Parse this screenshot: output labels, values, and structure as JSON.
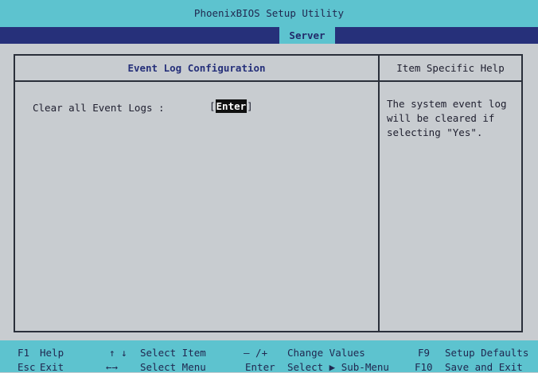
{
  "header": {
    "title": "PhoenixBIOS Setup Utility"
  },
  "menu": {
    "active_tab": "Server"
  },
  "panel": {
    "main_title": "Event Log Configuration",
    "help_title": "Item Specific Help",
    "items": [
      {
        "label": "Clear all Event Logs :",
        "value": "Enter"
      }
    ],
    "help_text": "The system event log\nwill be cleared if\nselecting \"Yes\"."
  },
  "statusbar": {
    "row1": {
      "k1": "F1",
      "d1": "Help",
      "k2": "↑ ↓",
      "d2": "Select Item",
      "k3": "– /+",
      "d3": "Change Values",
      "k4": "F9",
      "d4": "Setup Defaults"
    },
    "row2": {
      "k1": "Esc",
      "d1": "Exit",
      "k2": "←→",
      "d2": "Select Menu",
      "k3": "Enter",
      "d3": "Select ▶ Sub-Menu",
      "k4": "F10",
      "d4": "Save and Exit"
    }
  }
}
